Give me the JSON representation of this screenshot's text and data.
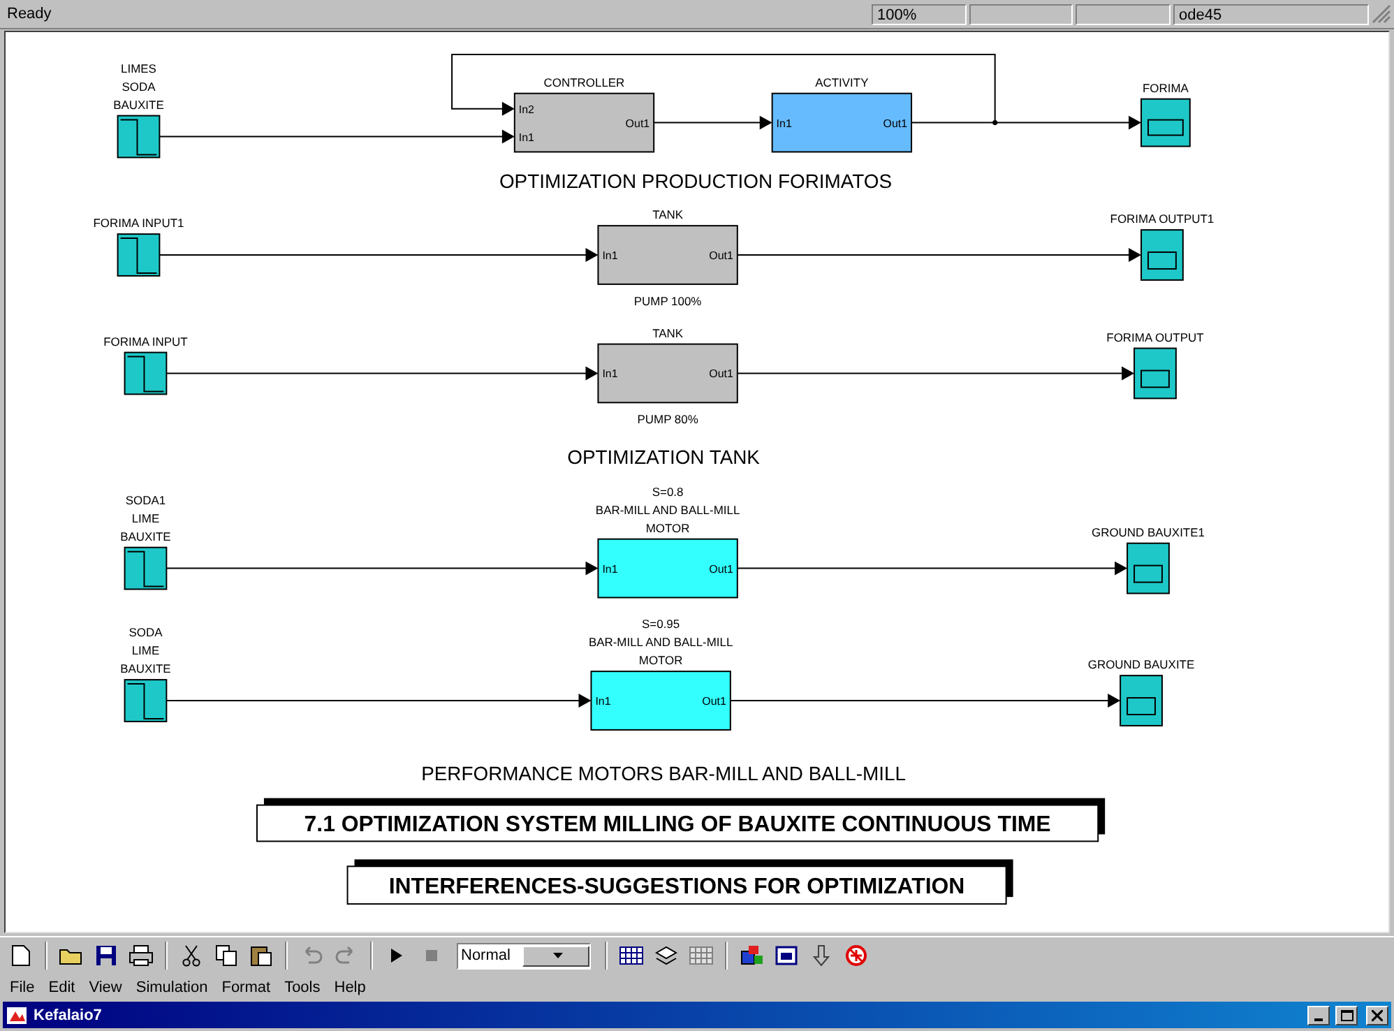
{
  "status_bar": {
    "message": "Ready",
    "zoom": "100%",
    "solver": "ode45"
  },
  "blocks": [
    {
      "kind": "source",
      "labels_above": [
        "LIMES",
        "SODA",
        "BAUXITE"
      ]
    },
    {
      "kind": "subsystem",
      "color": "#c0c0c0",
      "labels_above": [
        "CONTROLLER"
      ],
      "inputs": [
        "In2",
        "In1"
      ],
      "outputs": [
        "Out1"
      ]
    },
    {
      "kind": "subsystem",
      "color": "#66bbff",
      "labels_above": [
        "ACTIVITY"
      ],
      "inputs": [
        "In1"
      ],
      "outputs": [
        "Out1"
      ]
    },
    {
      "kind": "scope",
      "labels_above": [
        "FORIMA"
      ]
    },
    {
      "kind": "source",
      "labels_above": [
        "FORIMA INPUT1"
      ]
    },
    {
      "kind": "subsystem",
      "color": "#c0c0c0",
      "labels_above": [
        "TANK"
      ],
      "labels_below": [
        "PUMP 100%"
      ],
      "inputs": [
        "In1"
      ],
      "outputs": [
        "Out1"
      ]
    },
    {
      "kind": "scope",
      "labels_above": [
        "FORIMA OUTPUT1"
      ]
    },
    {
      "kind": "source",
      "labels_above": [
        "FORIMA INPUT"
      ]
    },
    {
      "kind": "subsystem",
      "color": "#c0c0c0",
      "labels_above": [
        "TANK"
      ],
      "labels_below": [
        "PUMP 80%"
      ],
      "inputs": [
        "In1"
      ],
      "outputs": [
        "Out1"
      ]
    },
    {
      "kind": "scope",
      "labels_above": [
        "FORIMA OUTPUT"
      ]
    },
    {
      "kind": "source",
      "labels_above": [
        "SODA1",
        "LIME",
        "BAUXITE"
      ]
    },
    {
      "kind": "subsystem",
      "color": "#33ffff",
      "labels_above": [
        "S=0.8",
        "BAR-MILL AND BALL-MILL",
        "MOTOR"
      ],
      "inputs": [
        "In1"
      ],
      "outputs": [
        "Out1"
      ]
    },
    {
      "kind": "scope",
      "labels_above": [
        "GROUND BAUXITE1"
      ]
    },
    {
      "kind": "source",
      "labels_above": [
        "SODA",
        "LIME",
        "BAUXITE"
      ]
    },
    {
      "kind": "subsystem",
      "color": "#33ffff",
      "labels_above": [
        "S=0.95",
        "BAR-MILL AND BALL-MILL",
        "MOTOR"
      ],
      "inputs": [
        "In1"
      ],
      "outputs": [
        "Out1"
      ]
    },
    {
      "kind": "scope",
      "labels_above": [
        "GROUND BAUXITE"
      ]
    }
  ],
  "captions": [
    "OPTIMIZATION PRODUCTION FORIMATOS",
    "OPTIMIZATION TANK",
    "PERFORMANCE MOTORS BAR-MILL AND BALL-MILL"
  ],
  "banners": [
    "7.1 OPTIMIZATION SYSTEM MILLING OF BAUXITE CONTINUOUS TIME",
    "INTERFERENCES-SUGGESTIONS FOR OPTIMIZATION"
  ],
  "toolbar": {
    "sim_mode": "Normal"
  },
  "menu": [
    "File",
    "Edit",
    "View",
    "Simulation",
    "Format",
    "Tools",
    "Help"
  ],
  "window": {
    "title": "Kefalaio7"
  }
}
